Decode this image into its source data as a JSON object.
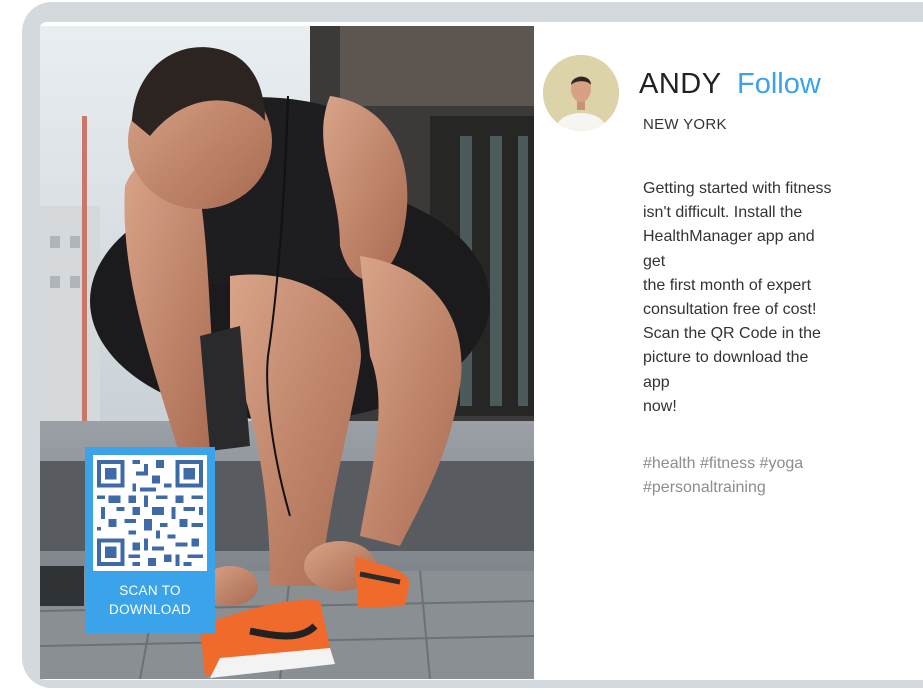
{
  "post": {
    "user": {
      "name": "ANDY",
      "follow_label": "Follow",
      "location": "NEW YORK"
    },
    "description_lines": [
      "Getting started with fitness",
      "isn't difficult. Install the",
      "HealthManager app and",
      "get",
      "the first month of expert",
      "consultation free of cost!",
      "Scan the QR Code in the",
      "picture to download the",
      "app",
      "now!"
    ],
    "hashtags": [
      "#health",
      "#fitness",
      "#yoga",
      "#personaltraining"
    ],
    "qr": {
      "label_line1": "SCAN TO",
      "label_line2": "DOWNLOAD"
    }
  },
  "colors": {
    "accent": "#3aa3e9",
    "frame": "#d4d9de",
    "hashtag": "#8d8d8d"
  }
}
